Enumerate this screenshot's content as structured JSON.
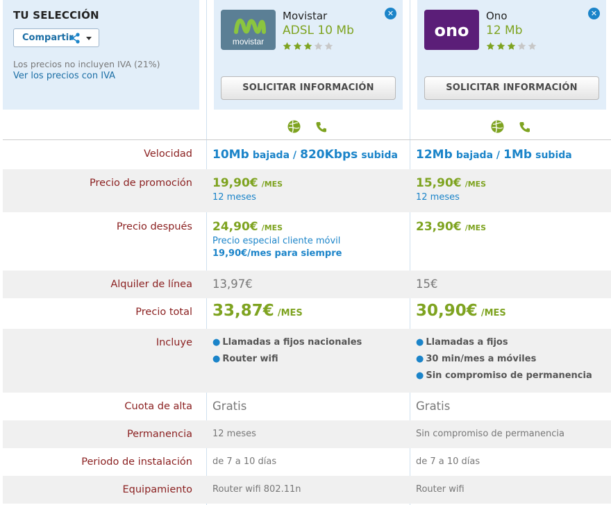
{
  "selection": {
    "title": "TU SELECCIÓN",
    "share_label": "Compartir",
    "iva_note": "Los precios no incluyen IVA (21%)",
    "iva_link": "Ver los precios con IVA"
  },
  "products": [
    {
      "name": "Movistar",
      "plan": "ADSL 10 Mb",
      "rating": 3,
      "rating_max": 5,
      "logo_text": "movistar",
      "logo_color": "#5b7f95",
      "request_label": "SOLICITAR INFORMACIÓN"
    },
    {
      "name": "Ono",
      "plan": "12 Mb",
      "rating": 3,
      "rating_max": 5,
      "logo_text": "ono",
      "logo_color": "#5b1e78",
      "request_label": "SOLICITAR INFORMACIÓN"
    }
  ],
  "labels": {
    "speed": "Velocidad",
    "promo": "Precio de promoción",
    "after": "Precio después",
    "line": "Alquiler de línea",
    "total": "Precio total",
    "includes": "Incluye",
    "signup": "Cuota de alta",
    "permanence": "Permanencia",
    "install": "Periodo de instalación",
    "equipment": "Equipamiento"
  },
  "rows": {
    "speed": [
      {
        "down": "10Mb",
        "down_txt": "bajada /",
        "up": "820Kbps",
        "up_txt": "subida"
      },
      {
        "down": "12Mb",
        "down_txt": "bajada /",
        "up": "1Mb",
        "up_txt": "subida"
      }
    ],
    "promo": [
      {
        "price": "19,90€",
        "per": "/MES",
        "note": "12 meses"
      },
      {
        "price": "15,90€",
        "per": "/MES",
        "note": "12 meses"
      }
    ],
    "after": [
      {
        "price": "24,90€",
        "per": "/MES",
        "note": "Precio especial cliente móvil",
        "note2": "19,90€/mes para siempre"
      },
      {
        "price": "23,90€",
        "per": "/MES",
        "note": "",
        "note2": ""
      }
    ],
    "line": [
      "13,97€",
      "15€"
    ],
    "total": [
      {
        "price": "33,87€",
        "per": "/MES"
      },
      {
        "price": "30,90€",
        "per": "/MES"
      }
    ],
    "includes": [
      [
        "Llamadas a fijos nacionales",
        "Router wifi"
      ],
      [
        "Llamadas a fijos",
        "30 min/mes a móviles",
        "Sin compromiso de permanencia"
      ]
    ],
    "signup": [
      "Gratis",
      "Gratis"
    ],
    "permanence": [
      "12 meses",
      "Sin compromiso de permanencia"
    ],
    "install": [
      "de 7 a 10 días",
      "de 7 a 10 días"
    ],
    "equipment": [
      "Router wifi 802.11n",
      "Router wifi"
    ]
  },
  "colors": {
    "accent_blue": "#1b84c9",
    "price_green": "#7ea320",
    "label_red": "#8a1f1f",
    "panel_bg": "#e2eef9"
  }
}
